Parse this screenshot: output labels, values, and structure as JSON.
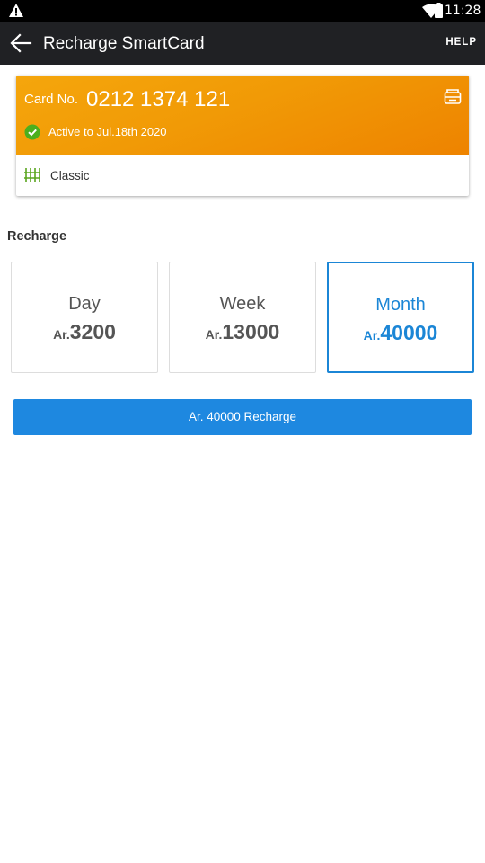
{
  "status_bar": {
    "time": "11:28",
    "icons": [
      "warning-icon",
      "wifi-icon",
      "battery-icon"
    ]
  },
  "app_bar": {
    "title": "Recharge SmartCard",
    "help_label": "HELP",
    "back_icon": "arrow-left-icon"
  },
  "card": {
    "number_label": "Card No.",
    "number": "0212 1374 121",
    "status_text": "Active to Jul.18th 2020",
    "plan_name": "Classic",
    "colors": {
      "gradient_start": "#f5a60c",
      "gradient_end": "#ee8300"
    }
  },
  "recharge": {
    "section_title": "Recharge",
    "plans": [
      {
        "name": "Day",
        "currency": "Ar.",
        "amount": "3200",
        "selected": false
      },
      {
        "name": "Week",
        "currency": "Ar.",
        "amount": "13000",
        "selected": false
      },
      {
        "name": "Month",
        "currency": "Ar.",
        "amount": "40000",
        "selected": true
      }
    ],
    "button_label": "Ar. 40000 Recharge"
  },
  "colors": {
    "accent": "#1b86d6",
    "button": "#1e88e0",
    "status_green": "#4caf1e"
  }
}
